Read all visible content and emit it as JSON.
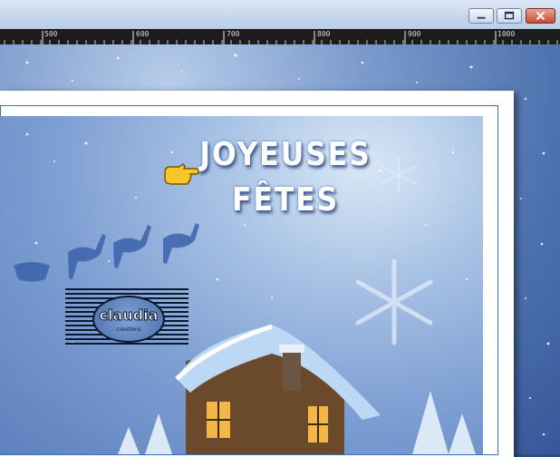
{
  "window": {
    "controls": {
      "minimize": "minimize-icon",
      "maximize": "maximize-icon",
      "close": "close-icon"
    }
  },
  "ruler": {
    "labels": [
      "500",
      "600",
      "700",
      "800",
      "900",
      "1000"
    ]
  },
  "artwork": {
    "greeting_line1": "JOYEUSES",
    "greeting_line2": "FÊTES",
    "watermark_name": "claudia",
    "watermark_sub": "creations"
  },
  "colors": {
    "canvas_blue": "#4f73af",
    "frame_white": "#ffffff",
    "frame_border": "#3c6fb7",
    "close_red": "#c94a32"
  }
}
